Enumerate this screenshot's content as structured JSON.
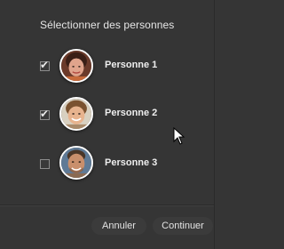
{
  "dialog": {
    "title": "Sélectionner des personnes"
  },
  "people": [
    {
      "name": "Personne 1",
      "checked": true,
      "checkbox_mark": "✔",
      "avatar_icon": "person-1-photo"
    },
    {
      "name": "Personne 2",
      "checked": true,
      "checkbox_mark": "✔",
      "avatar_icon": "person-2-photo"
    },
    {
      "name": "Personne 3",
      "checked": false,
      "checkbox_mark": "",
      "avatar_icon": "person-3-photo"
    }
  ],
  "buttons": {
    "cancel_label": "Annuler",
    "continue_label": "Continuer"
  },
  "colors": {
    "background": "#353535",
    "text": "#e6e6e6",
    "button_background": "#3b3b3b",
    "avatar_border": "#ffffff"
  },
  "cursor_icon": "arrow-cursor-icon"
}
